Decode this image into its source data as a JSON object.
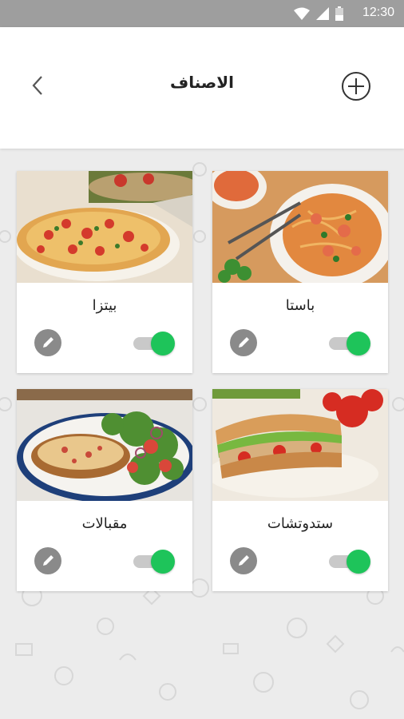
{
  "status_bar": {
    "time": "12:30"
  },
  "header": {
    "title": "الاصناف"
  },
  "categories": [
    {
      "name": "باستا",
      "enabled": true
    },
    {
      "name": "بيتزا",
      "enabled": true
    },
    {
      "name": "ستدوتشات",
      "enabled": true
    },
    {
      "name": "مقبالات",
      "enabled": true
    }
  ],
  "colors": {
    "accent_green": "#1ec45a",
    "status_bar": "#9e9e9e",
    "background": "#ececec"
  }
}
